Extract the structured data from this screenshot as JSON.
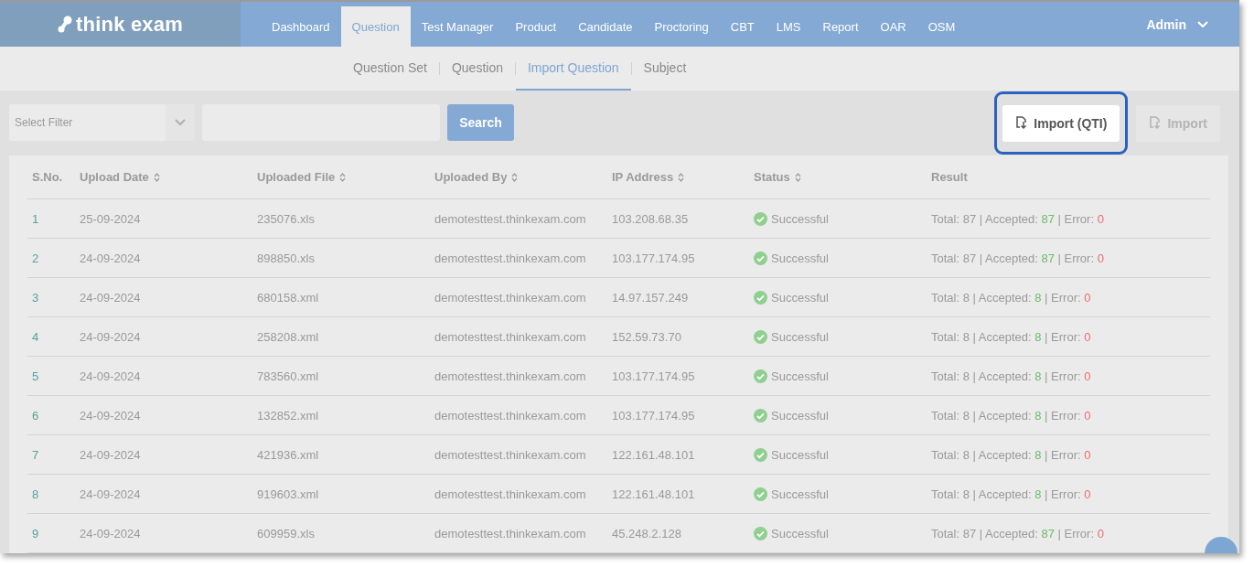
{
  "header": {
    "logo": "think exam",
    "nav": [
      {
        "label": "Dashboard",
        "selected": false
      },
      {
        "label": "Question",
        "selected": true
      },
      {
        "label": "Test Manager",
        "selected": false
      },
      {
        "label": "Product",
        "selected": false
      },
      {
        "label": "Candidate",
        "selected": false
      },
      {
        "label": "Proctoring",
        "selected": false
      },
      {
        "label": "CBT",
        "selected": false
      },
      {
        "label": "LMS",
        "selected": false
      },
      {
        "label": "Report",
        "selected": false
      },
      {
        "label": "OAR",
        "selected": false
      },
      {
        "label": "OSM",
        "selected": false
      }
    ],
    "user": "Admin"
  },
  "subnav": [
    {
      "label": "Question Set",
      "selected": false
    },
    {
      "label": "Question",
      "selected": false
    },
    {
      "label": "Import Question",
      "selected": true
    },
    {
      "label": "Subject",
      "selected": false
    }
  ],
  "toolbar": {
    "filter": {
      "placeholder": "Select Filter"
    },
    "search_button": "Search",
    "buttons": [
      {
        "label": "Import (QTI)",
        "disabled": false,
        "highlighted": true
      },
      {
        "label": "Import",
        "disabled": true,
        "highlighted": false
      }
    ]
  },
  "table": {
    "columns": [
      {
        "label": "S.No.",
        "sortable": false
      },
      {
        "label": "Upload Date",
        "sortable": true
      },
      {
        "label": "Uploaded File",
        "sortable": true
      },
      {
        "label": "Uploaded By",
        "sortable": true
      },
      {
        "label": "IP Address",
        "sortable": true
      },
      {
        "label": "Status",
        "sortable": true
      },
      {
        "label": "Result",
        "sortable": false
      }
    ],
    "rows": [
      {
        "sno": "1",
        "date": "25-09-2024",
        "file": "235076.xls",
        "by": "demotesttest.thinkexam.com",
        "ip": "103.208.68.35",
        "status": "Successful",
        "result": [
          {
            "kind": "plain",
            "text": "Total: 87 | Accepted: "
          },
          {
            "kind": "ok",
            "text": "87"
          },
          {
            "kind": "plain",
            "text": " | Error: "
          },
          {
            "kind": "error",
            "text": "0"
          }
        ]
      },
      {
        "sno": "2",
        "date": "24-09-2024",
        "file": "898850.xls",
        "by": "demotesttest.thinkexam.com",
        "ip": "103.177.174.95",
        "status": "Successful",
        "result": [
          {
            "kind": "plain",
            "text": "Total: 87 | Accepted: "
          },
          {
            "kind": "ok",
            "text": "87"
          },
          {
            "kind": "plain",
            "text": " | Error: "
          },
          {
            "kind": "error",
            "text": "0"
          }
        ]
      },
      {
        "sno": "3",
        "date": "24-09-2024",
        "file": "680158.xml",
        "by": "demotesttest.thinkexam.com",
        "ip": "14.97.157.249",
        "status": "Successful",
        "result": [
          {
            "kind": "plain",
            "text": "Total: 8 | Accepted: "
          },
          {
            "kind": "ok",
            "text": "8"
          },
          {
            "kind": "plain",
            "text": " | Error: "
          },
          {
            "kind": "error",
            "text": "0"
          }
        ]
      },
      {
        "sno": "4",
        "date": "24-09-2024",
        "file": "258208.xml",
        "by": "demotesttest.thinkexam.com",
        "ip": "152.59.73.70",
        "status": "Successful",
        "result": [
          {
            "kind": "plain",
            "text": "Total: 8 | Accepted: "
          },
          {
            "kind": "ok",
            "text": "8"
          },
          {
            "kind": "plain",
            "text": " | Error: "
          },
          {
            "kind": "error",
            "text": "0"
          }
        ]
      },
      {
        "sno": "5",
        "date": "24-09-2024",
        "file": "783560.xml",
        "by": "demotesttest.thinkexam.com",
        "ip": "103.177.174.95",
        "status": "Successful",
        "result": [
          {
            "kind": "plain",
            "text": "Total: 8 | Accepted: "
          },
          {
            "kind": "ok",
            "text": "8"
          },
          {
            "kind": "plain",
            "text": " | Error: "
          },
          {
            "kind": "error",
            "text": "0"
          }
        ]
      },
      {
        "sno": "6",
        "date": "24-09-2024",
        "file": "132852.xml",
        "by": "demotesttest.thinkexam.com",
        "ip": "103.177.174.95",
        "status": "Successful",
        "result": [
          {
            "kind": "plain",
            "text": "Total: 8 | Accepted: "
          },
          {
            "kind": "ok",
            "text": "8"
          },
          {
            "kind": "plain",
            "text": " | Error: "
          },
          {
            "kind": "error",
            "text": "0"
          }
        ]
      },
      {
        "sno": "7",
        "date": "24-09-2024",
        "file": "421936.xml",
        "by": "demotesttest.thinkexam.com",
        "ip": "122.161.48.101",
        "status": "Successful",
        "result": [
          {
            "kind": "plain",
            "text": "Total: 8 | Accepted: "
          },
          {
            "kind": "ok",
            "text": "8"
          },
          {
            "kind": "plain",
            "text": " | Error: "
          },
          {
            "kind": "error",
            "text": "0"
          }
        ]
      },
      {
        "sno": "8",
        "date": "24-09-2024",
        "file": "919603.xml",
        "by": "demotesttest.thinkexam.com",
        "ip": "122.161.48.101",
        "status": "Successful",
        "result": [
          {
            "kind": "plain",
            "text": "Total: 8 | Accepted: "
          },
          {
            "kind": "ok",
            "text": "8"
          },
          {
            "kind": "plain",
            "text": " | Error: "
          },
          {
            "kind": "error",
            "text": "0"
          }
        ]
      },
      {
        "sno": "9",
        "date": "24-09-2024",
        "file": "609959.xls",
        "by": "demotesttest.thinkexam.com",
        "ip": "45.248.2.128",
        "status": "Successful",
        "result": [
          {
            "kind": "plain",
            "text": "Total: 87 | Accepted: "
          },
          {
            "kind": "ok",
            "text": "87"
          },
          {
            "kind": "plain",
            "text": " | Error: "
          },
          {
            "kind": "error",
            "text": "0"
          }
        ]
      }
    ]
  }
}
